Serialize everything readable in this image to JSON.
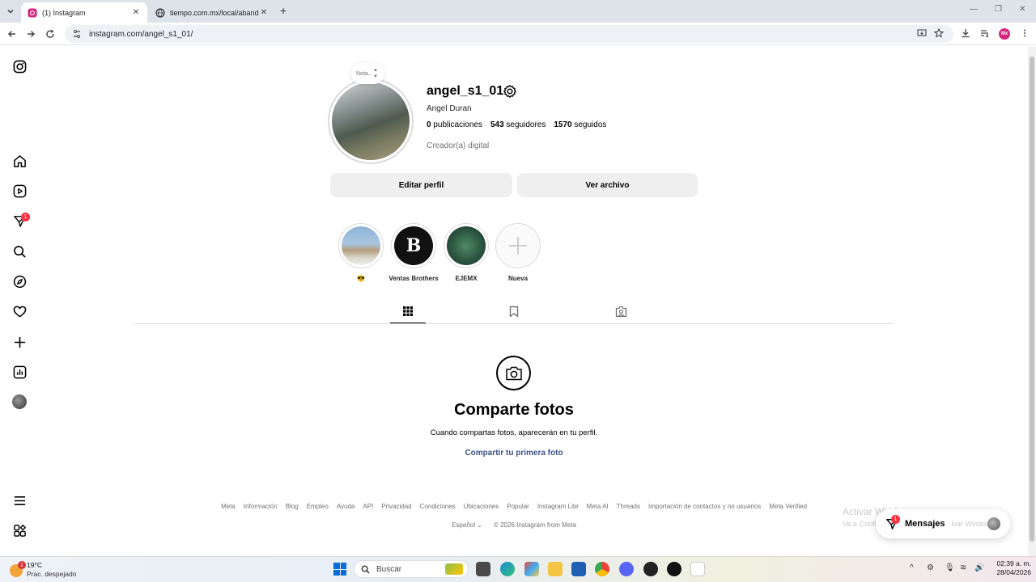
{
  "browser": {
    "tabs": [
      {
        "title": "(1) Instagram",
        "active": true
      },
      {
        "title": "tiempo.com.mx/local/abandone",
        "active": false
      }
    ],
    "url": "instagram.com/angel_s1_01/",
    "profile_initials": "Mx"
  },
  "sidebar": {
    "notification_count": "1",
    "items": [
      "instagram-logo",
      "home",
      "reels",
      "messages",
      "search",
      "explore",
      "notifications",
      "create",
      "dashboard",
      "profile",
      "more",
      "meta-apps"
    ]
  },
  "profile": {
    "note": "Nota...",
    "username": "angel_s1_01",
    "full_name": "Angel Duran",
    "stats": {
      "posts_count": "0",
      "posts_label": "publicaciones",
      "followers_count": "543",
      "followers_label": "seguidores",
      "following_count": "1570",
      "following_label": "seguidos"
    },
    "category": "Creador(a) digital",
    "edit_button": "Editar perfil",
    "archive_button": "Ver archivo"
  },
  "highlights": [
    {
      "label": "😎"
    },
    {
      "label": "Ventas Brothers"
    },
    {
      "label": "EJEMX"
    },
    {
      "label": "Nueva"
    }
  ],
  "empty_state": {
    "title": "Comparte fotos",
    "subtitle": "Cuando compartas fotos, aparecerán en tu perfil.",
    "link": "Compartir tu primera foto"
  },
  "footer": {
    "links": [
      "Meta",
      "Información",
      "Blog",
      "Empleo",
      "Ayuda",
      "API",
      "Privacidad",
      "Condiciones",
      "Ubicaciones",
      "Popular",
      "Instagram Lite",
      "Meta AI",
      "Threads",
      "Importación de contactos y no usuarios",
      "Meta Verified"
    ],
    "language": "Español",
    "copyright": "© 2026 Instagram from Meta"
  },
  "watermark": {
    "line1": "Activar Windows",
    "line2": "Ve a Configu"
  },
  "messages_pill": {
    "label": "Mensajes",
    "ghost_text": "ivar Windows",
    "badge": "1"
  },
  "taskbar": {
    "weather_temp": "19°C",
    "weather_desc": "Prac. despejado",
    "weather_badge": "1",
    "search_placeholder": "Buscar",
    "time": "02:39 a. m.",
    "date": "28/04/2026"
  },
  "colors": {
    "notification_red": "#ff3040",
    "link_blue": "#385185",
    "button_gray": "#efefef"
  }
}
